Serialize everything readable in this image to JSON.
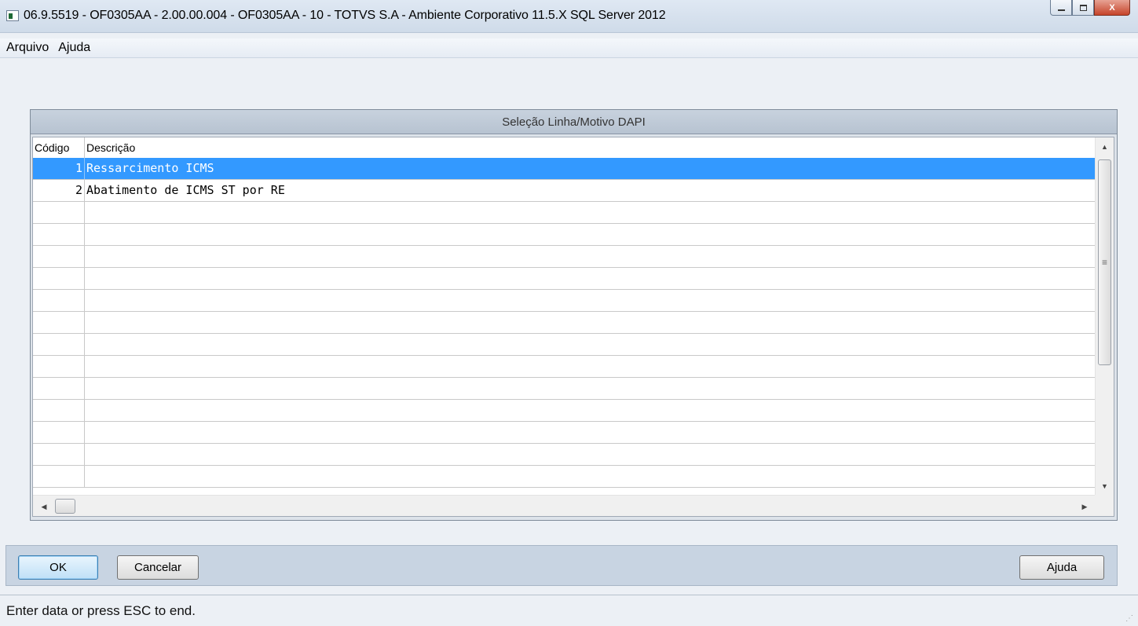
{
  "window": {
    "title": "06.9.5519 - OF0305AA - 2.00.00.004 - OF0305AA - 10 - TOTVS S.A - Ambiente Corporativo 11.5.X SQL Server 2012",
    "minimize_icon": "minimize-icon",
    "maximize_icon": "maximize-icon",
    "close_label": "X"
  },
  "menu": {
    "items": [
      "Arquivo",
      "Ajuda"
    ]
  },
  "frame": {
    "title": "Seleção Linha/Motivo DAPI"
  },
  "grid": {
    "columns": [
      "Código",
      "Descrição"
    ],
    "rows": [
      {
        "code": "1",
        "description": "Ressarcimento ICMS",
        "selected": true
      },
      {
        "code": "2",
        "description": "Abatimento de ICMS ST por RE",
        "selected": false
      }
    ],
    "empty_rows": 13,
    "selected_color": "#3399ff"
  },
  "buttons": {
    "ok": "OK",
    "cancel": "Cancelar",
    "help": "Ajuda"
  },
  "status": {
    "text": "Enter data or press ESC to end."
  }
}
